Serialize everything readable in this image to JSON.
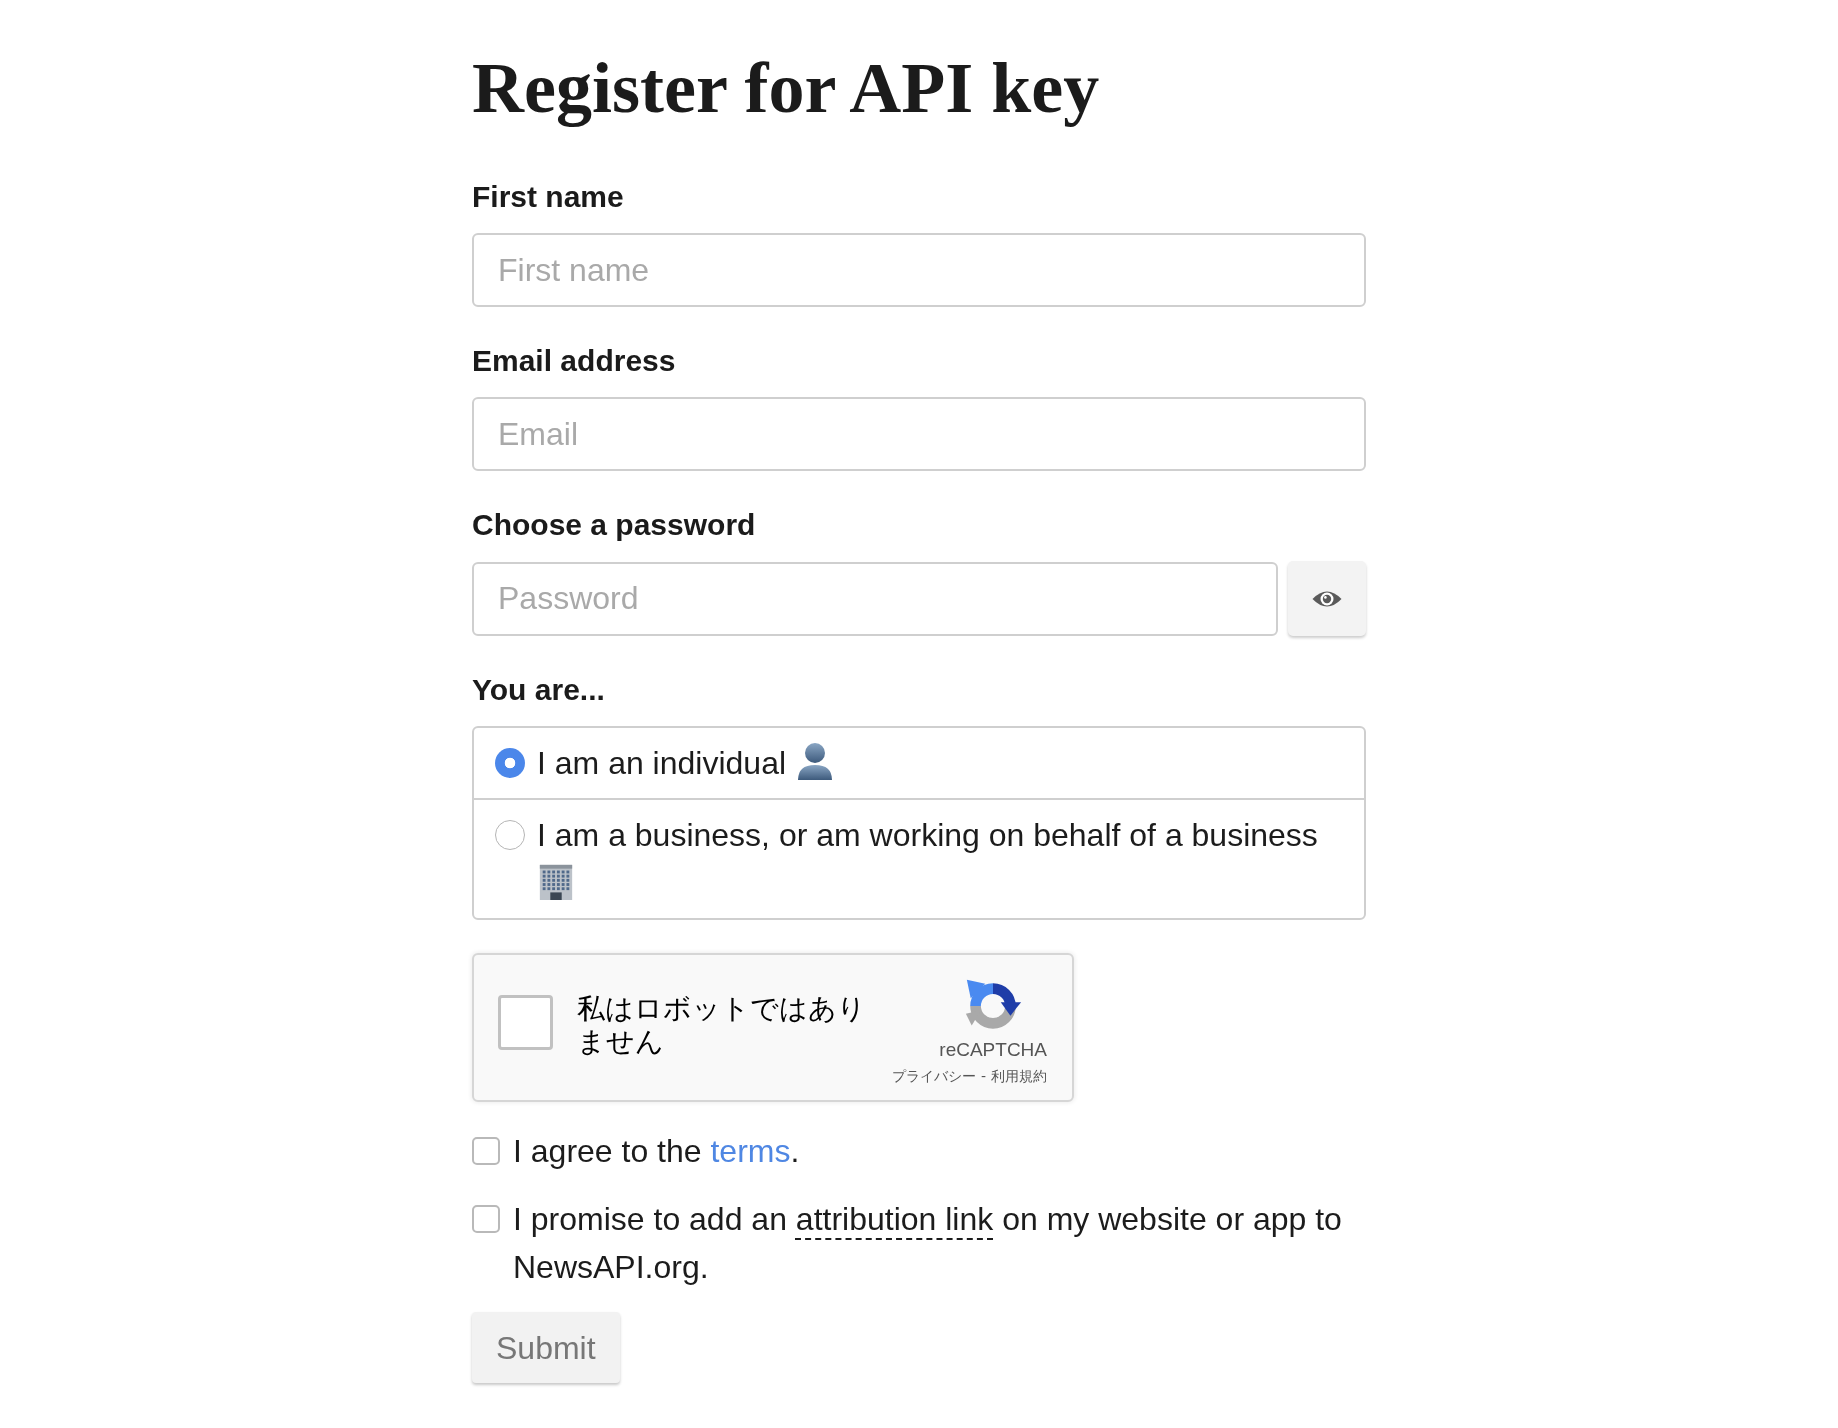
{
  "title": "Register for API key",
  "fields": [
    {
      "kind": "text",
      "label": "First name",
      "placeholder": "First name"
    },
    {
      "kind": "text",
      "label": "Email address",
      "placeholder": "Email"
    },
    {
      "kind": "password",
      "label": "Choose a password",
      "placeholder": "Password"
    }
  ],
  "account_type": {
    "label": "You are...",
    "options": [
      {
        "kind": "individual",
        "label": "I am an individual",
        "selected": true
      },
      {
        "kind": "business",
        "label": "I am a business, or am working on behalf of a business",
        "selected": false
      }
    ]
  },
  "captcha": {
    "label": "私はロボットではありません",
    "checked": false,
    "brand": "reCAPTCHA",
    "privacy_link": "プライバシー",
    "separator": "-",
    "terms_link": "利用規約"
  },
  "agreements": [
    {
      "checked": false,
      "parts": [
        {
          "kind": "plain",
          "text": "I agree to the "
        },
        {
          "kind": "link",
          "text": "terms"
        },
        {
          "kind": "plain",
          "text": "."
        }
      ]
    },
    {
      "checked": false,
      "parts": [
        {
          "kind": "plain",
          "text": "I promise to add an "
        },
        {
          "kind": "term",
          "text": "attribution link"
        },
        {
          "kind": "plain",
          "text": " on my website or app to NewsAPI.org."
        }
      ]
    }
  ],
  "submit": {
    "label": "Submit",
    "disabled": true
  }
}
